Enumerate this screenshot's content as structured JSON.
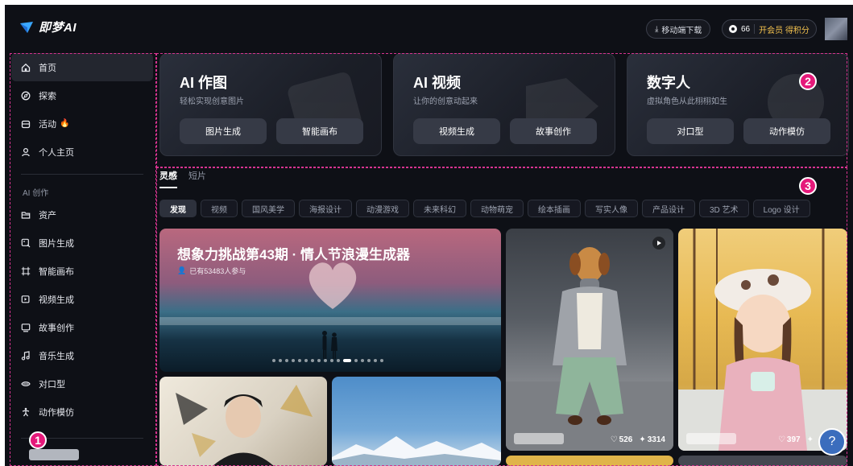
{
  "header": {
    "logo_text": "即梦AI",
    "download_label": "移动端下载",
    "credits_value": "66",
    "membership_label": "开会员 得积分"
  },
  "sidebar": {
    "items": [
      {
        "label": "首页",
        "icon": "home-icon",
        "active": true
      },
      {
        "label": "探索",
        "icon": "compass-icon"
      },
      {
        "label": "活动",
        "icon": "calendar-icon",
        "badge": "🔥"
      },
      {
        "label": "个人主页",
        "icon": "user-icon"
      }
    ],
    "section_title": "AI 创作",
    "create_items": [
      {
        "label": "资产",
        "icon": "folder-icon"
      },
      {
        "label": "图片生成",
        "icon": "image-gen-icon"
      },
      {
        "label": "智能画布",
        "icon": "canvas-icon"
      },
      {
        "label": "视频生成",
        "icon": "video-gen-icon"
      },
      {
        "label": "故事创作",
        "icon": "story-icon"
      },
      {
        "label": "音乐生成",
        "icon": "music-icon"
      },
      {
        "label": "对口型",
        "icon": "lipsync-icon"
      },
      {
        "label": "动作模仿",
        "icon": "motion-icon"
      }
    ]
  },
  "cards": [
    {
      "title": "AI 作图",
      "subtitle": "轻松实现创意图片",
      "buttons": [
        "图片生成",
        "智能画布"
      ]
    },
    {
      "title": "AI 视频",
      "subtitle": "让你的创意动起来",
      "buttons": [
        "视频生成",
        "故事创作"
      ]
    },
    {
      "title": "数字人",
      "subtitle": "虚拟角色从此栩栩如生",
      "buttons": [
        "对口型",
        "动作模仿"
      ]
    }
  ],
  "tabs": [
    "灵感",
    "短片"
  ],
  "chips": [
    "发现",
    "视频",
    "国风美学",
    "海报设计",
    "动漫游戏",
    "未来科幻",
    "动物萌宠",
    "绘本插画",
    "写实人像",
    "产品设计",
    "3D 艺术",
    "Logo 设计"
  ],
  "banner": {
    "title": "想象力挑战第43期 · 情人节浪漫生成器",
    "participants": "已有53483人参与"
  },
  "gallery": [
    {
      "likes": "526",
      "uses": "3314"
    },
    {
      "likes": "397"
    }
  ],
  "help_label": "?",
  "annotations": [
    "1",
    "2",
    "3"
  ],
  "colors": {
    "accent_annotation": "#e5197a",
    "background": "#0e1016",
    "help_button": "#3b6dbd"
  }
}
